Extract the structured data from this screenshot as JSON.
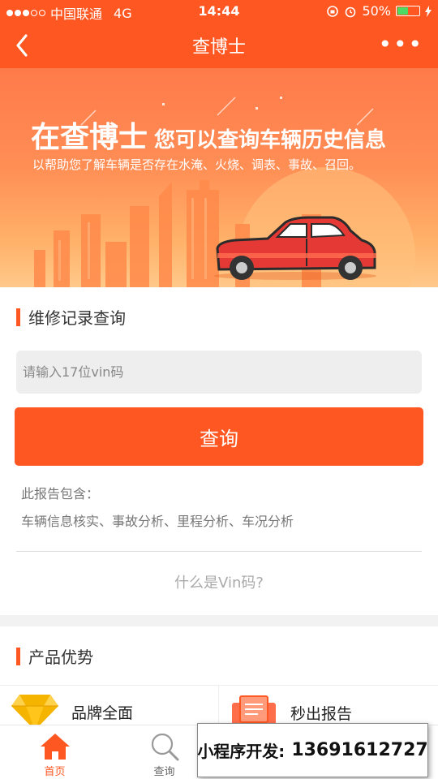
{
  "status_bar": {
    "carrier": "中国联通",
    "network": "4G",
    "time": "14:44",
    "battery": "50%",
    "battery_level": 0.5,
    "icons": [
      "signal-dots-icon",
      "rotation-lock-icon",
      "alarm-icon",
      "battery-icon",
      "charging-bolt-icon"
    ]
  },
  "nav": {
    "title": "查博士",
    "back_icon": "chevron-left-icon",
    "more_label": "•••"
  },
  "banner": {
    "headline_big": "在查博士",
    "headline_small": "您可以查询车辆历史信息",
    "subline": "以帮助您了解车辆是否存在水淹、火烧、调表、事故、召回。"
  },
  "query": {
    "section_title": "维修记录查询",
    "vin_placeholder": "请输入17位vin码",
    "button_label": "查询",
    "report_label": "此报告包含：",
    "report_items": "车辆信息核实、事故分析、里程分析、车况分析",
    "what_is_vin": "什么是Vin码?"
  },
  "advantages": {
    "section_title": "产品优势",
    "items": [
      {
        "label": "品牌全面",
        "icon": "diamond-icon"
      },
      {
        "label": "秒出报告",
        "icon": "report-document-icon"
      }
    ]
  },
  "tabs": [
    {
      "label": "首页",
      "icon": "home-icon",
      "active": true
    },
    {
      "label": "查询",
      "icon": "search-icon",
      "active": false
    },
    {
      "label": "",
      "icon": "tab-3-icon",
      "active": false
    },
    {
      "label": "",
      "icon": "tab-4-icon",
      "active": false
    }
  ],
  "watermark": {
    "prefix": "小程序开发:",
    "phone": "13691612727"
  },
  "colors": {
    "accent": "#ff5722",
    "battery_fill": "#4cd964",
    "gold": "#f5b400"
  }
}
